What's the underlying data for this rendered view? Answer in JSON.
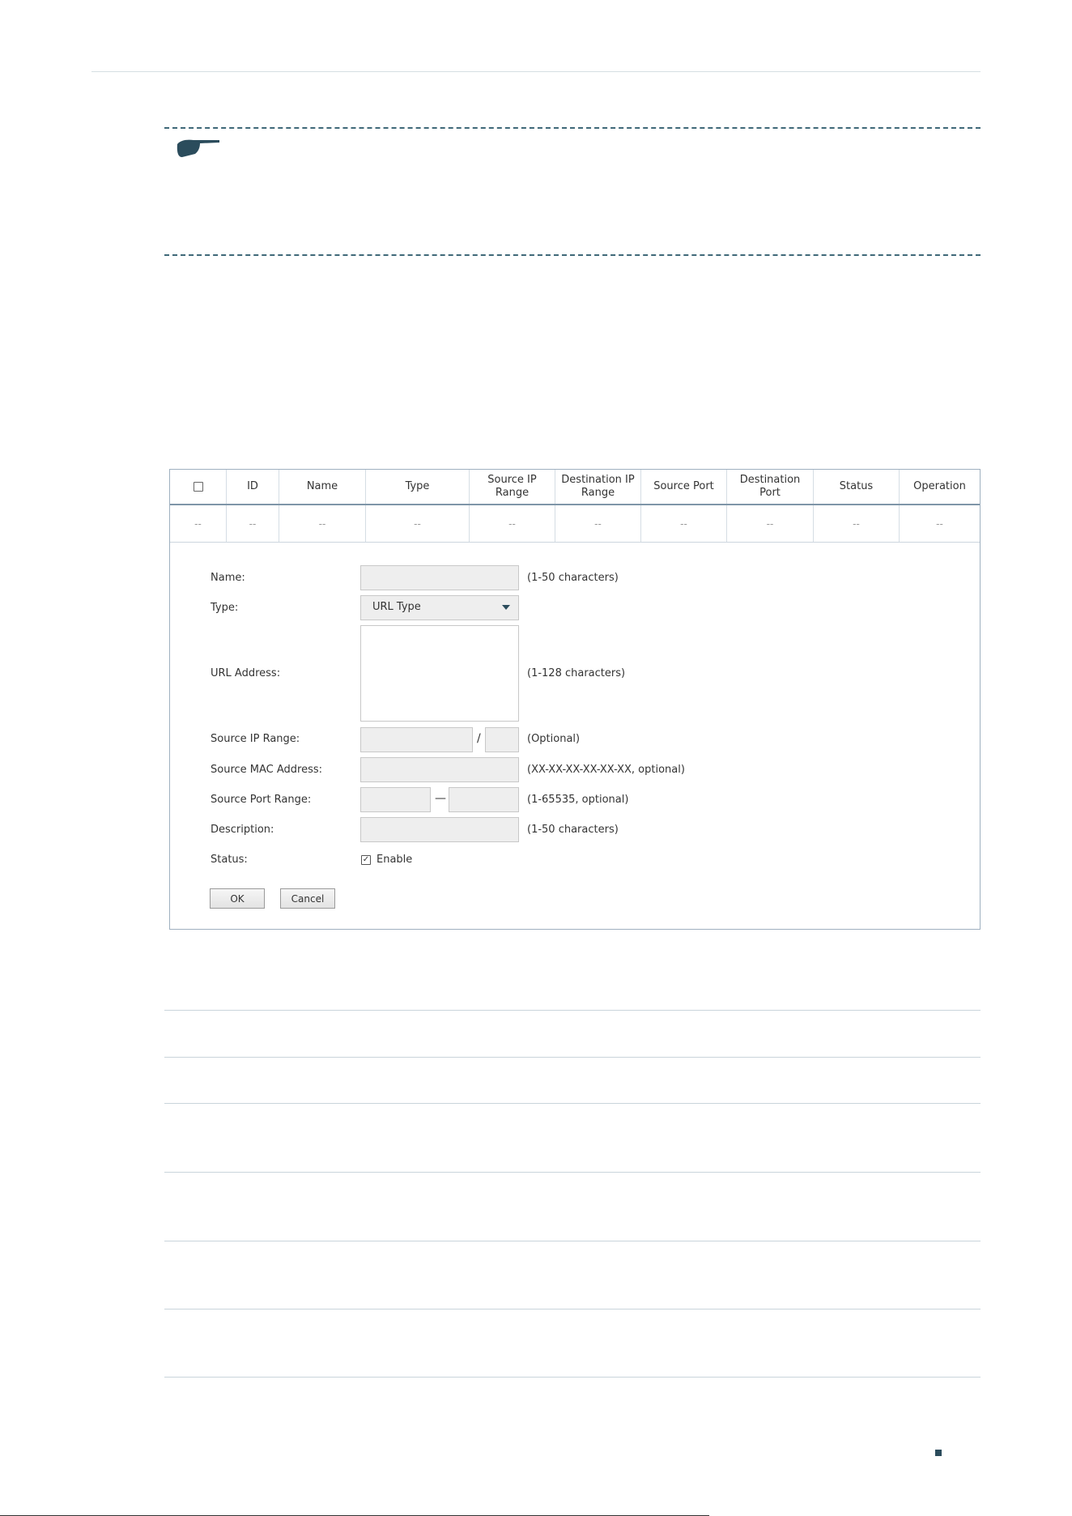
{
  "grid": {
    "headers": [
      "ID",
      "Name",
      "Type",
      "Source IP Range",
      "Destination IP Range",
      "Source Port",
      "Destination Port",
      "Status",
      "Operation"
    ],
    "empty_row": [
      "--",
      "--",
      "--",
      "--",
      "--",
      "--",
      "--",
      "--",
      "--",
      "--"
    ]
  },
  "form": {
    "name_label": "Name:",
    "name_hint": "(1-50 characters)",
    "type_label": "Type:",
    "type_value": "URL Type",
    "url_label": "URL Address:",
    "url_hint": "(1-128 characters)",
    "src_ip_label": "Source IP Range:",
    "src_ip_sep": "/",
    "src_ip_hint": "(Optional)",
    "src_mac_label": "Source MAC Address:",
    "src_mac_hint": "(XX-XX-XX-XX-XX-XX, optional)",
    "src_port_label": "Source Port Range:",
    "src_port_sep": "—",
    "src_port_hint": "(1-65535, optional)",
    "desc_label": "Description:",
    "desc_hint": "(1-50 characters)",
    "status_label": "Status:",
    "enable_label": "Enable",
    "ok_label": "OK",
    "cancel_label": "Cancel"
  },
  "colors": {
    "accent": "#2b4c5c",
    "dashed": "#3f6878",
    "field_bg": "#eeeeee"
  },
  "icons": {
    "note": "pointing-hand-icon",
    "caret": "caret-down-icon",
    "check": "checkmark-icon",
    "page": "page-marker-icon"
  }
}
